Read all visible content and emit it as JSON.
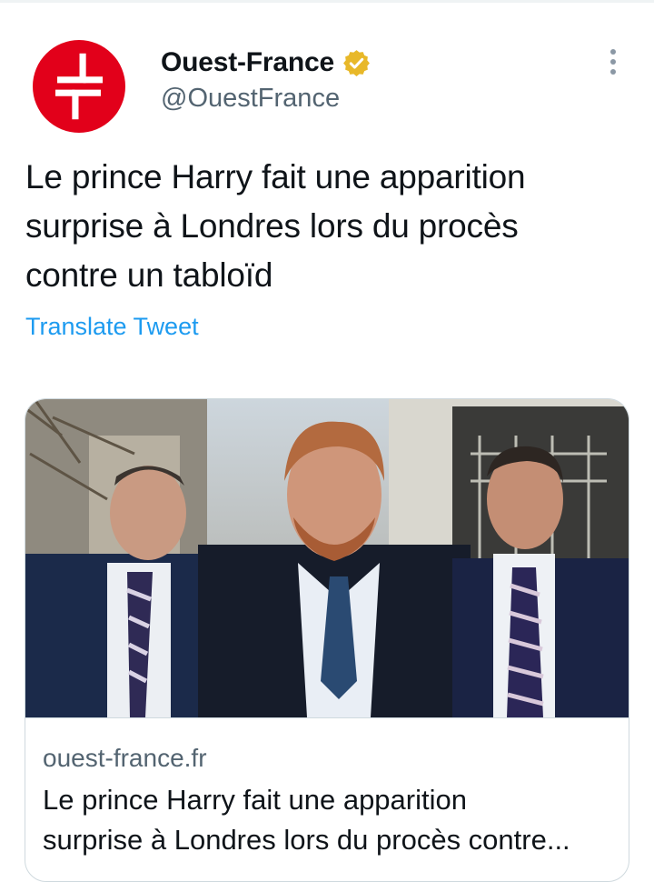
{
  "account": {
    "display_name": "Ouest-France",
    "handle": "@OuestFrance",
    "verified": true,
    "avatar_color": "#e2001a",
    "verified_color": "#e8b829"
  },
  "tweet": {
    "lines": [
      "Le prince Harry fait une apparition",
      "surprise à Londres lors du procès",
      "contre un tabloïd"
    ],
    "translate_label": "Translate Tweet"
  },
  "link_card": {
    "domain": "ouest-france.fr",
    "title_line1": "Le prince Harry fait une apparition",
    "title_line2": "surprise à Londres lors du procès contre..."
  },
  "icons": {
    "more": "more-vertical-icon",
    "verified": "verified-badge-icon",
    "avatar": "ouest-france-logo"
  },
  "colors": {
    "link": "#1d9bf0",
    "secondary_text": "#536471",
    "border": "#cfd9de"
  }
}
